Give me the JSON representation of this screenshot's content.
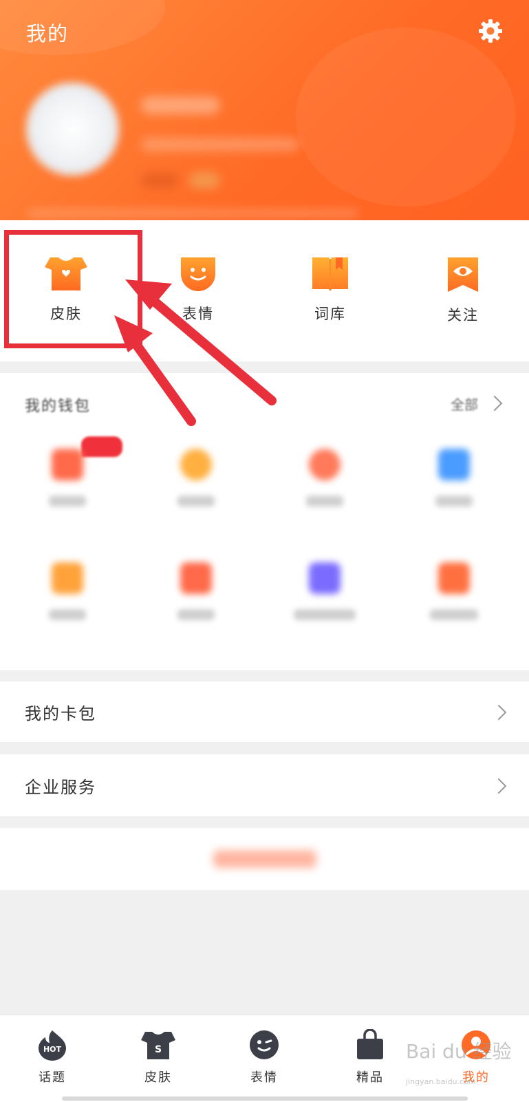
{
  "header": {
    "title": "我的",
    "settings_icon": "gear-icon"
  },
  "quick_entries": [
    {
      "label": "皮肤",
      "icon": "tshirt-heart-icon"
    },
    {
      "label": "表情",
      "icon": "smiley-icon"
    },
    {
      "label": "词库",
      "icon": "book-icon"
    },
    {
      "label": "关注",
      "icon": "eye-icon"
    }
  ],
  "wallet": {
    "title": "我的钱包",
    "all_label": "全部"
  },
  "rows": {
    "card_pack": "我的卡包",
    "enterprise": "企业服务"
  },
  "tabbar": {
    "items": [
      {
        "label": "话题",
        "icon": "hot-icon"
      },
      {
        "label": "皮肤",
        "icon": "tshirt-icon"
      },
      {
        "label": "表情",
        "icon": "emoji-icon"
      },
      {
        "label": "精品",
        "icon": "shopping-bag-icon"
      },
      {
        "label": "我的",
        "icon": "user-icon",
        "active": true
      }
    ]
  },
  "watermark": {
    "brand": "Bai du 经验",
    "url": "jingyan.baidu.com"
  },
  "colors": {
    "accent": "#ff6a26",
    "annotation": "#e8303c"
  }
}
